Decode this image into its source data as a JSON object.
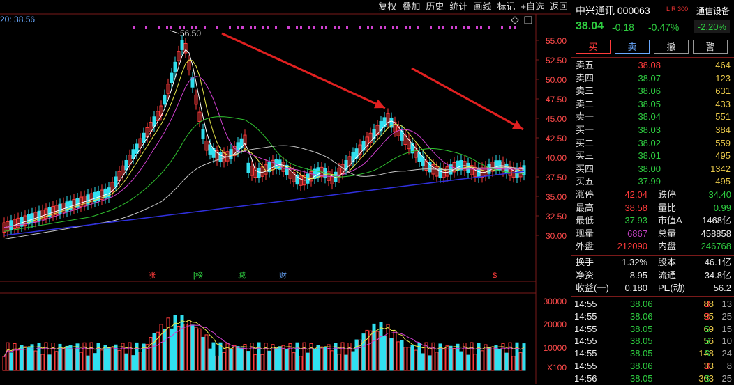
{
  "toolbar": [
    "复权",
    "叠加",
    "历史",
    "统计",
    "画线",
    "标记",
    "+自选",
    "返回"
  ],
  "ma_label": "20: 38.56",
  "peak_label": "56.50",
  "price_axis": [
    "55.00",
    "52.50",
    "50.00",
    "47.50",
    "45.00",
    "42.50",
    "40.00",
    "37.50",
    "35.00",
    "32.50",
    "30.00"
  ],
  "vol_axis": [
    "30000",
    "20000",
    "10000",
    "X100"
  ],
  "events": [
    {
      "text": "涨",
      "color": "#ff3b3b"
    },
    {
      "text": "[榜",
      "color": "#2ecc40"
    },
    {
      "text": "减",
      "color": "#2ecc40"
    },
    {
      "text": "财",
      "color": "#6aa9ff"
    },
    {
      "text": "$",
      "color": "#ff3b3b"
    }
  ],
  "header": {
    "name": "中兴通讯",
    "code": "000063",
    "badge": "L R 300",
    "sector": "通信设备",
    "price": "38.04",
    "change": "-0.18",
    "pct": "-0.47%",
    "sector_pct": "-2.20%"
  },
  "trade_buttons": [
    {
      "label": "买",
      "color": "#ff3b3b"
    },
    {
      "label": "卖",
      "color": "#6aa9ff"
    },
    {
      "label": "撤",
      "color": "#ddd"
    },
    {
      "label": "警",
      "color": "#ddd"
    }
  ],
  "asks": [
    {
      "label": "卖五",
      "price": "38.08",
      "vol": "464",
      "pc": "red"
    },
    {
      "label": "卖四",
      "price": "38.07",
      "vol": "123",
      "pc": "green"
    },
    {
      "label": "卖三",
      "price": "38.06",
      "vol": "631",
      "pc": "green"
    },
    {
      "label": "卖二",
      "price": "38.05",
      "vol": "433",
      "pc": "green"
    },
    {
      "label": "卖一",
      "price": "38.04",
      "vol": "551",
      "pc": "green"
    }
  ],
  "bids": [
    {
      "label": "买一",
      "price": "38.03",
      "vol": "384",
      "pc": "green"
    },
    {
      "label": "买二",
      "price": "38.02",
      "vol": "559",
      "pc": "green"
    },
    {
      "label": "买三",
      "price": "38.01",
      "vol": "495",
      "pc": "green"
    },
    {
      "label": "买四",
      "price": "38.00",
      "vol": "1342",
      "pc": "green"
    },
    {
      "label": "买五",
      "price": "37.99",
      "vol": "495",
      "pc": "green"
    }
  ],
  "stats1": [
    {
      "l": "涨停",
      "v": "42.04",
      "vc": "red",
      "l2": "跌停",
      "v2": "34.40",
      "v2c": "green"
    },
    {
      "l": "最高",
      "v": "38.58",
      "vc": "red",
      "l2": "量比",
      "v2": "0.99",
      "v2c": "green"
    },
    {
      "l": "最低",
      "v": "37.93",
      "vc": "green",
      "l2": "市值A",
      "v2": "1468亿",
      "v2c": "white"
    },
    {
      "l": "现量",
      "v": "6867",
      "vc": "purple",
      "l2": "总量",
      "v2": "458858",
      "v2c": "white"
    },
    {
      "l": "外盘",
      "v": "212090",
      "vc": "red",
      "l2": "内盘",
      "v2": "246768",
      "v2c": "green"
    }
  ],
  "stats2": [
    {
      "l": "换手",
      "v": "1.32%",
      "l2": "股本",
      "v2": "46.1亿"
    },
    {
      "l": "净资",
      "v": "8.95",
      "l2": "流通",
      "v2": "34.8亿"
    },
    {
      "l": "收益(一)",
      "v": "0.180",
      "l2": "PE(动)",
      "v2": "56.2"
    }
  ],
  "ticks": [
    {
      "t": "14:55",
      "p": "38.06",
      "v": "88",
      "s": "B",
      "n": "13"
    },
    {
      "t": "14:55",
      "p": "38.06",
      "v": "95",
      "s": "B",
      "n": "25"
    },
    {
      "t": "14:55",
      "p": "38.05",
      "v": "69",
      "s": "S",
      "n": "15"
    },
    {
      "t": "14:55",
      "p": "38.05",
      "v": "56",
      "s": "S",
      "n": "10"
    },
    {
      "t": "14:55",
      "p": "38.05",
      "v": "148",
      "s": "S",
      "n": "24"
    },
    {
      "t": "14:55",
      "p": "38.06",
      "v": "33",
      "s": "B",
      "n": "8"
    },
    {
      "t": "14:56",
      "p": "38.05",
      "v": "303",
      "s": "S",
      "n": "25"
    }
  ],
  "colors": {
    "up": "#ff3b3b",
    "down": "#2ecc40",
    "cyan": "#30e0f0",
    "ma1": "#ffffff",
    "ma2": "#e8e84a",
    "ma3": "#d040d0",
    "ma4": "#30c030",
    "ma5": "#c8c8c8",
    "ma6": "#3030e0",
    "arrow": "#e02020",
    "grid": "#7a1a1a"
  }
}
